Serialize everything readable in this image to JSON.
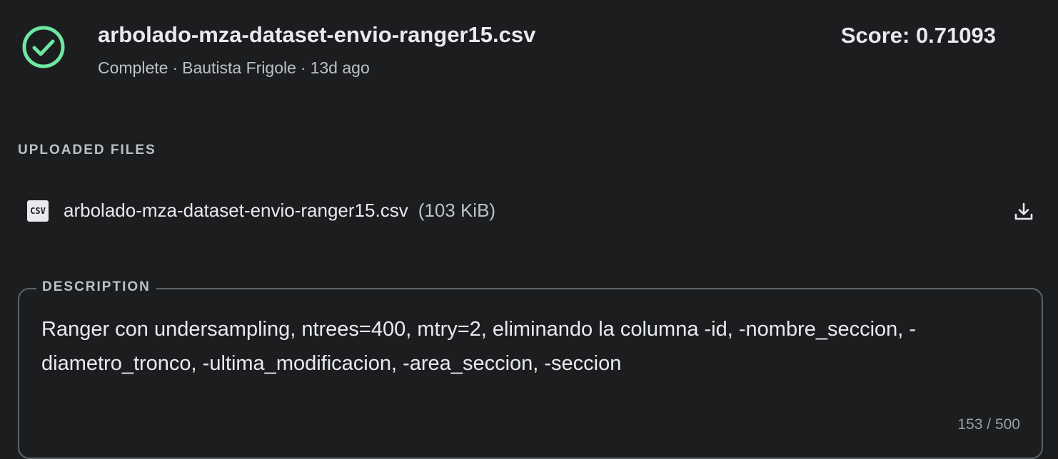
{
  "submission": {
    "file_name": "arbolado-mza-dataset-envio-ranger15.csv",
    "status": "Complete",
    "author": "Bautista Frigole",
    "age": "13d ago",
    "separator": "·",
    "score": "Score: 0.71093",
    "status_icon": "check-circle-icon",
    "status_color": "#6ee7a0"
  },
  "uploaded_files": {
    "label": "UPLOADED FILES",
    "files": [
      {
        "icon": "csv-file-icon",
        "icon_text": "CSV",
        "name": "arbolado-mza-dataset-envio-ranger15.csv",
        "size": "(103 KiB)",
        "action_icon": "download-icon"
      }
    ]
  },
  "description": {
    "label": "DESCRIPTION",
    "value": "Ranger con undersampling, ntrees=400, mtry=2, eliminando la columna -id, -nombre_seccion, -diametro_tronco, -ultima_modificacion, -area_seccion, -seccion",
    "char_count": "153 / 500"
  }
}
